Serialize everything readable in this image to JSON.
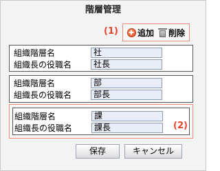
{
  "dialog": {
    "title": "階層管理"
  },
  "annotations": {
    "one": "(1)",
    "two": "(2)"
  },
  "toolbar": {
    "add_label": "追加",
    "delete_label": "削除"
  },
  "groups": [
    {
      "layer_label": "組織階層名",
      "layer_value": "社",
      "role_label": "組織長の役職名",
      "role_value": "社長"
    },
    {
      "layer_label": "組織階層名",
      "layer_value": "部",
      "role_label": "組織長の役職名",
      "role_value": "部長"
    },
    {
      "layer_label": "組織階層名",
      "layer_value": "課",
      "role_label": "組織長の役職名",
      "role_value": "課長"
    }
  ],
  "footer": {
    "save_label": "保存",
    "cancel_label": "キャンセル"
  },
  "colors": {
    "annotation": "#e8412c",
    "field_bg": "#e9edf8",
    "highlight_border": "#ef8a7a"
  }
}
